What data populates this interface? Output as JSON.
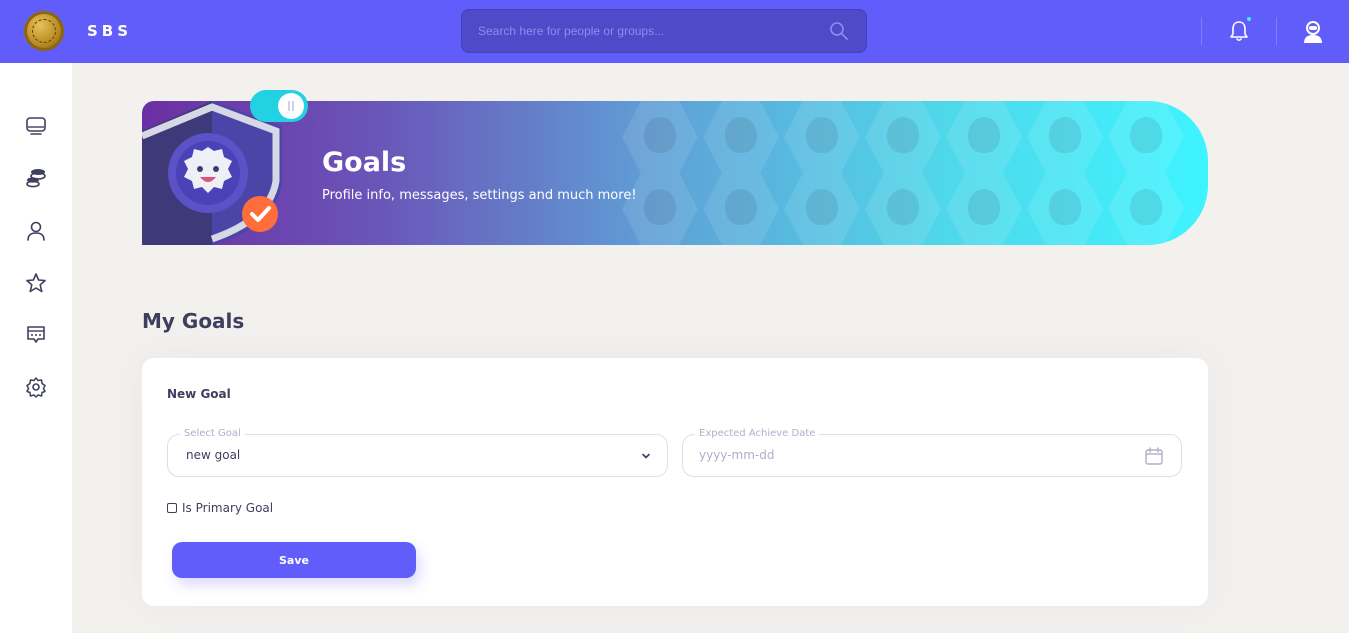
{
  "header": {
    "brand": "SBS",
    "search_placeholder": "Search here for people or groups...",
    "accent_color": "#615dfa",
    "notification_dot_color": "#41efff"
  },
  "sidebar": {
    "items": [
      {
        "name": "newsfeed",
        "icon": "monitor-icon"
      },
      {
        "name": "coins",
        "icon": "coins-icon"
      },
      {
        "name": "profile",
        "icon": "user-icon"
      },
      {
        "name": "favorites",
        "icon": "star-icon"
      },
      {
        "name": "messages",
        "icon": "chat-icon"
      },
      {
        "name": "settings",
        "icon": "gear-icon"
      }
    ]
  },
  "banner": {
    "title": "Goals",
    "subtitle": "Profile info, messages, settings and much more!"
  },
  "main": {
    "section_title": "My Goals",
    "card": {
      "title": "New Goal",
      "select_goal": {
        "label": "Select Goal",
        "value": "new goal"
      },
      "date": {
        "label": "Expected Achieve Date",
        "placeholder": "yyyy-mm-dd"
      },
      "primary_checkbox": {
        "label": "Is Primary Goal",
        "checked": false
      },
      "save_label": "Save"
    }
  }
}
